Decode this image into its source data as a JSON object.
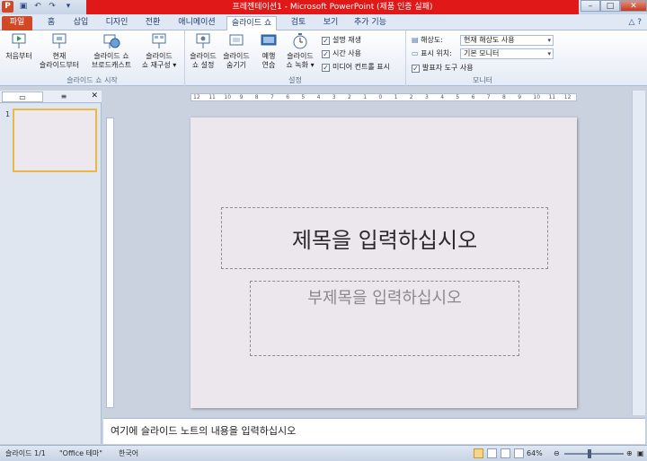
{
  "window": {
    "title": "프레젠테이션1 - Microsoft PowerPoint (제품 인증 실패)"
  },
  "tabs": [
    {
      "label": "파일"
    },
    {
      "label": "홈"
    },
    {
      "label": "삽입"
    },
    {
      "label": "디자인"
    },
    {
      "label": "전환"
    },
    {
      "label": "애니메이션"
    },
    {
      "label": "슬라이드 쇼"
    },
    {
      "label": "검토"
    },
    {
      "label": "보기"
    },
    {
      "label": "추가 기능"
    }
  ],
  "ribbon": {
    "start_group": {
      "label": "슬라이드 쇼 시작",
      "from_beginning": "처음부터",
      "from_current_1": "현재",
      "from_current_2": "슬라이드부터",
      "broadcast_1": "슬라이드 쇼",
      "broadcast_2": "브로드캐스트",
      "custom_1": "슬라이드",
      "custom_2": "쇼 재구성 ▾"
    },
    "setup_group": {
      "label": "설정",
      "setup_1": "슬라이드",
      "setup_2": "쇼 설정",
      "hide_1": "슬라이드",
      "hide_2": "숨기기",
      "rehearse_1": "예행",
      "rehearse_2": "연습",
      "record_1": "슬라이드",
      "record_2": "쇼 녹화 ▾",
      "chk_narration": "설명 재생",
      "chk_timings": "시간 사용",
      "chk_media": "미디어 컨트롤 표시"
    },
    "monitor_group": {
      "label": "모니터",
      "resolution_label": "해상도:",
      "resolution_value": "현재 해상도 사용",
      "show_on_label": "표시 위치:",
      "show_on_value": "기본 모니터",
      "presenter_view": "발표자 도구 사용"
    }
  },
  "left_panel": {
    "tab_slides": "",
    "tab_outline": "",
    "thumb_number": "1"
  },
  "slide": {
    "title_placeholder": "제목을 입력하십시오",
    "subtitle_placeholder": "부제목을 입력하십시오"
  },
  "ruler": {
    "h_ticks": [
      "12",
      "11",
      "10",
      "9",
      "8",
      "7",
      "6",
      "5",
      "4",
      "3",
      "2",
      "1",
      "0",
      "1",
      "2",
      "3",
      "4",
      "5",
      "6",
      "7",
      "8",
      "9",
      "10",
      "11",
      "12"
    ]
  },
  "notes": {
    "placeholder": "여기에 슬라이드 노트의 내용을 입력하십시오"
  },
  "status": {
    "slide": "슬라이드 1/1",
    "theme": "\"Office 테마\"",
    "language": "한국어",
    "zoom": "64%",
    "zoom_level": 0.42
  }
}
